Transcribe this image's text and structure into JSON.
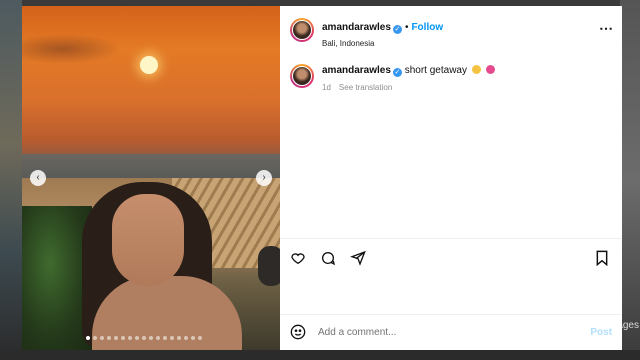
{
  "post": {
    "username": "amandarawles",
    "separator": "•",
    "follow_label": "Follow",
    "location": "Bali, Indonesia",
    "more_icon": "⋯"
  },
  "caption": {
    "username": "amandarawles",
    "text": "short getaway",
    "time": "1d",
    "see_translation": "See translation"
  },
  "media": {
    "current_slide": 1,
    "total_slides": 17
  },
  "comment": {
    "placeholder": "Add a comment...",
    "post_label": "Post"
  },
  "background": {
    "partial_text": "ages"
  },
  "colors": {
    "follow": "#0095f6",
    "verified": "#3897f0",
    "post_disabled": "#b2dffc"
  }
}
